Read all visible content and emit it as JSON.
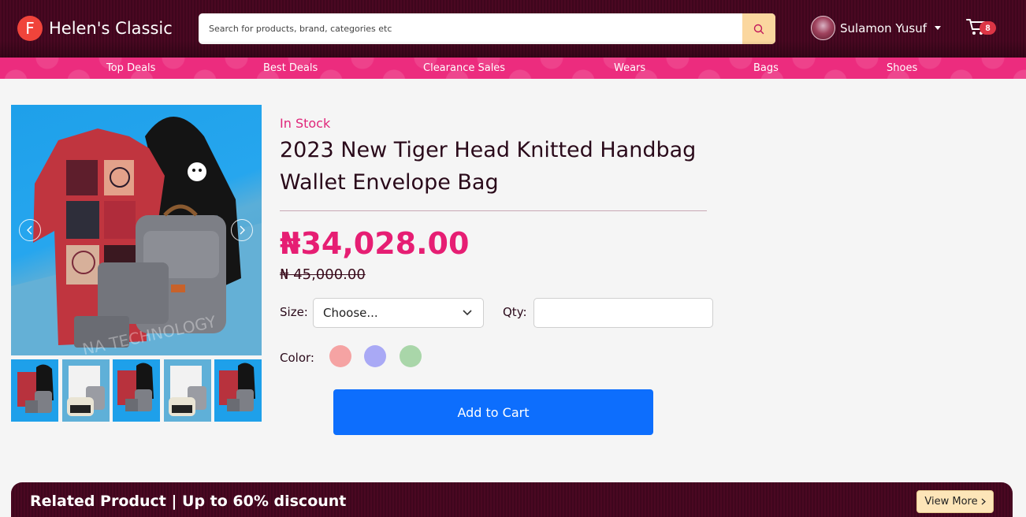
{
  "header": {
    "logo_letter": "F",
    "brand_name": "Helen's Classic",
    "search": {
      "placeholder": "Search for products, brand, categories etc",
      "value": ""
    },
    "user": {
      "name": "Sulamon Yusuf"
    },
    "cart": {
      "count": "8"
    }
  },
  "categories": [
    "Top Deals",
    "Best Deals",
    "Clearance Sales",
    "Wears",
    "Bags",
    "Shoes"
  ],
  "product": {
    "stock_status": "In Stock",
    "title": "2023 New Tiger Head Knitted Handbag Wallet Envelope Bag",
    "price": "₦34,028.00",
    "old_price": "₦ 45,000.00",
    "image_watermark": "NA TECHNOLOGY",
    "size_label": "Size:",
    "size_value": "Choose...",
    "qty_label": "Qty:",
    "qty_value": "",
    "color_label": "Color:",
    "colors": [
      "#f5a3a3",
      "#a9a9f5",
      "#a9d6a9"
    ],
    "add_to_cart_label": "Add to Cart"
  },
  "related": {
    "title": "Related Product | Up to 60% discount",
    "view_more_label": "View More"
  },
  "icons": {
    "search": "search-icon",
    "cart": "cart-icon",
    "prev": "chevron-left-icon",
    "next": "chevron-right-icon",
    "select": "chevron-down-icon"
  }
}
